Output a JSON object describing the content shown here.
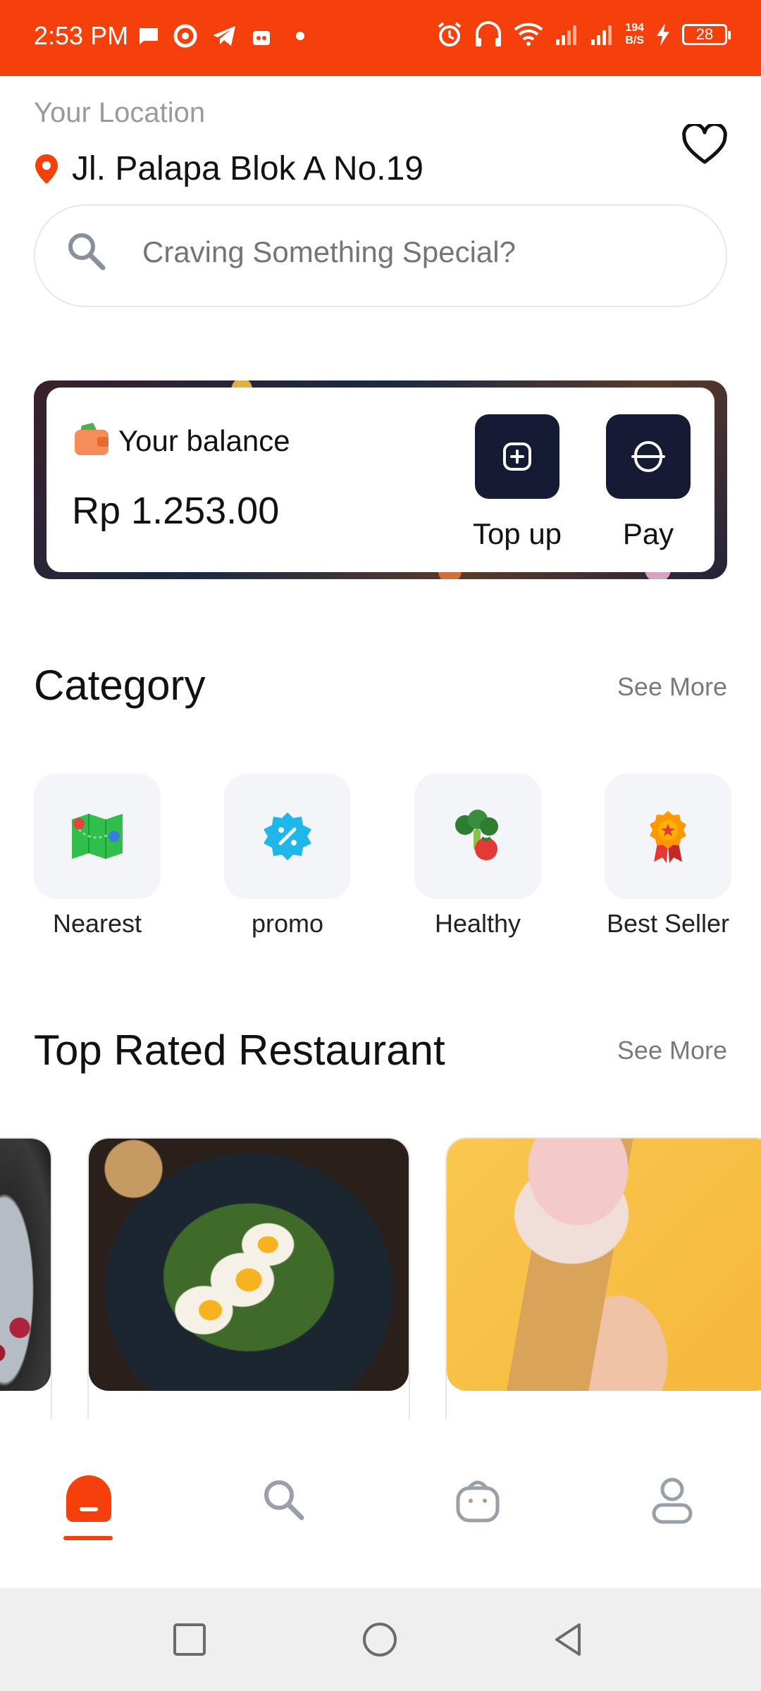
{
  "status_bar": {
    "time": "2:53 PM",
    "net_speed_value": "194",
    "net_speed_unit": "B/S",
    "battery": "28",
    "bg_color": "#F5400C"
  },
  "header": {
    "location_label": "Your Location",
    "location_value": "Jl. Palapa Blok A No.19"
  },
  "search": {
    "placeholder": "Craving Something Special?"
  },
  "balance": {
    "label": "Your balance",
    "amount": "Rp 1.253.00",
    "actions": [
      {
        "label": "Top up",
        "icon": "plus-square-icon"
      },
      {
        "label": "Pay",
        "icon": "scan-icon"
      }
    ]
  },
  "category": {
    "title": "Category",
    "see_more": "See More",
    "items": [
      {
        "label": "Nearest",
        "icon": "map-icon"
      },
      {
        "label": "promo",
        "icon": "discount-badge-icon"
      },
      {
        "label": "Healthy",
        "icon": "broccoli-tomato-icon"
      },
      {
        "label": "Best Seller",
        "icon": "award-medal-icon"
      }
    ]
  },
  "top_rated": {
    "title": "Top Rated Restaurant",
    "see_more": "See More",
    "cards": [
      {
        "image": "berries-bowl-image"
      },
      {
        "image": "egg-salad-image"
      },
      {
        "image": "ice-cream-cone-image"
      }
    ]
  },
  "bottom_nav": {
    "items": [
      {
        "name": "home",
        "icon": "home-icon",
        "active": true
      },
      {
        "name": "search",
        "icon": "search-icon",
        "active": false
      },
      {
        "name": "basket",
        "icon": "basket-icon",
        "active": false
      },
      {
        "name": "profile",
        "icon": "user-icon",
        "active": false
      }
    ],
    "accent": "#F5400C"
  }
}
